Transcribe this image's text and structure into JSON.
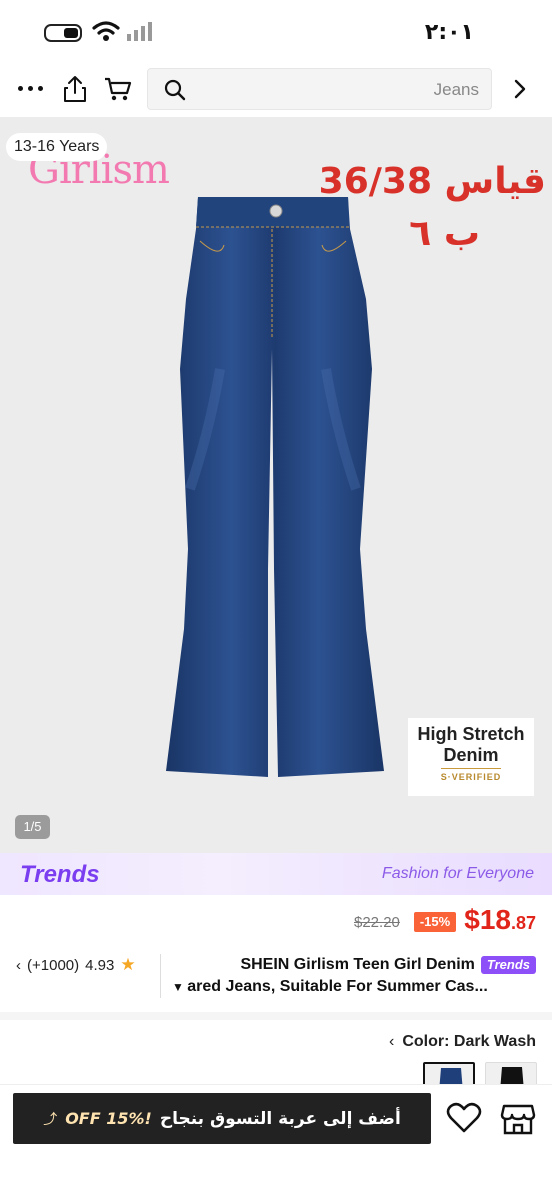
{
  "status_bar": {
    "time": "٢:٠١"
  },
  "search": {
    "placeholder": "Jeans"
  },
  "product_image": {
    "age_badge": "13-16 Years",
    "brand": "Girlism",
    "size_note": "قياس 36/38",
    "size_price": "ب ٦",
    "feature_line1": "High Stretch",
    "feature_line2": "Denim",
    "feature_verified": "S·VERIFIED",
    "page_counter": "1/5"
  },
  "trends_banner": {
    "logo": "Trends",
    "tagline": "Fashion for Everyone"
  },
  "price": {
    "original": "$22.20",
    "discount": "-15%",
    "currency": "$",
    "whole": "18",
    "cents": ".87"
  },
  "rating": {
    "score": "4.93",
    "count": "(+1000)"
  },
  "title": {
    "line1": "SHEIN Girlism Teen Girl Denim",
    "tag": "Trends",
    "line2": "ared Jeans, Suitable For Summer Cas..."
  },
  "color": {
    "label": "Color: Dark Wash"
  },
  "bottom_bar": {
    "add_to_cart": "أضف إلى عربة التسوق بنجاح",
    "promo": "!15% OFF"
  },
  "colors": {
    "accent_red": "#e1251b",
    "trends_purple": "#8d4ff7",
    "denim": "#1f3f7a"
  }
}
